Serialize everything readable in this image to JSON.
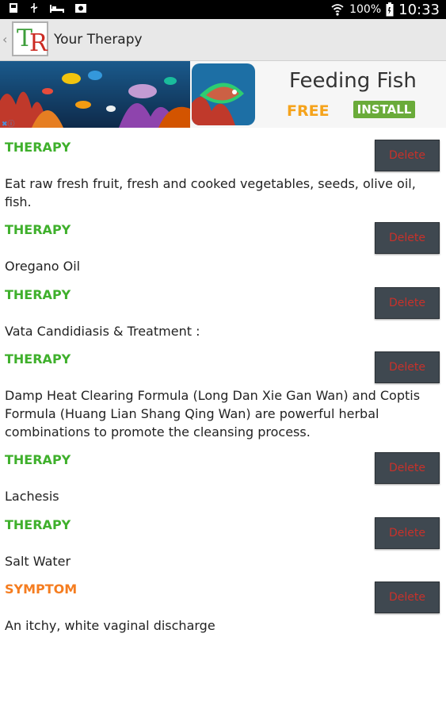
{
  "status_bar": {
    "battery": "100%",
    "time": "10:33"
  },
  "action_bar": {
    "title": "Your Therapy",
    "logo_letters": [
      "T",
      "R"
    ]
  },
  "ad": {
    "title": "Feeding Fish",
    "price": "FREE",
    "install_label": "INSTALL"
  },
  "entries": [
    {
      "tag": "THERAPY",
      "type": "therapy",
      "delete_label": "Delete",
      "text": "Eat  raw fresh fruit, fresh and cooked vegetables, seeds, olive oil, fish."
    },
    {
      "tag": "THERAPY",
      "type": "therapy",
      "delete_label": "Delete",
      "text": "Oregano Oil"
    },
    {
      "tag": "THERAPY",
      "type": "therapy",
      "delete_label": "Delete",
      "text": "Vata Candidiasis & Treatment :"
    },
    {
      "tag": "THERAPY",
      "type": "therapy",
      "delete_label": "Delete",
      "text": "Damp Heat Clearing Formula (Long Dan Xie Gan Wan) and Coptis Formula (Huang Lian Shang Qing Wan) are powerful herbal combinations to promote the cleansing process."
    },
    {
      "tag": "THERAPY",
      "type": "therapy",
      "delete_label": "Delete",
      "text": "Lachesis"
    },
    {
      "tag": "THERAPY",
      "type": "therapy",
      "delete_label": "Delete",
      "text": "Salt Water"
    },
    {
      "tag": "SYMPTOM",
      "type": "symptom",
      "delete_label": "Delete",
      "text": "An itchy, white vaginal discharge"
    }
  ],
  "colors": {
    "therapy": "#3fb02c",
    "symptom": "#f57d20",
    "delete_text": "#c8312a",
    "delete_bg": "#3f4850"
  }
}
